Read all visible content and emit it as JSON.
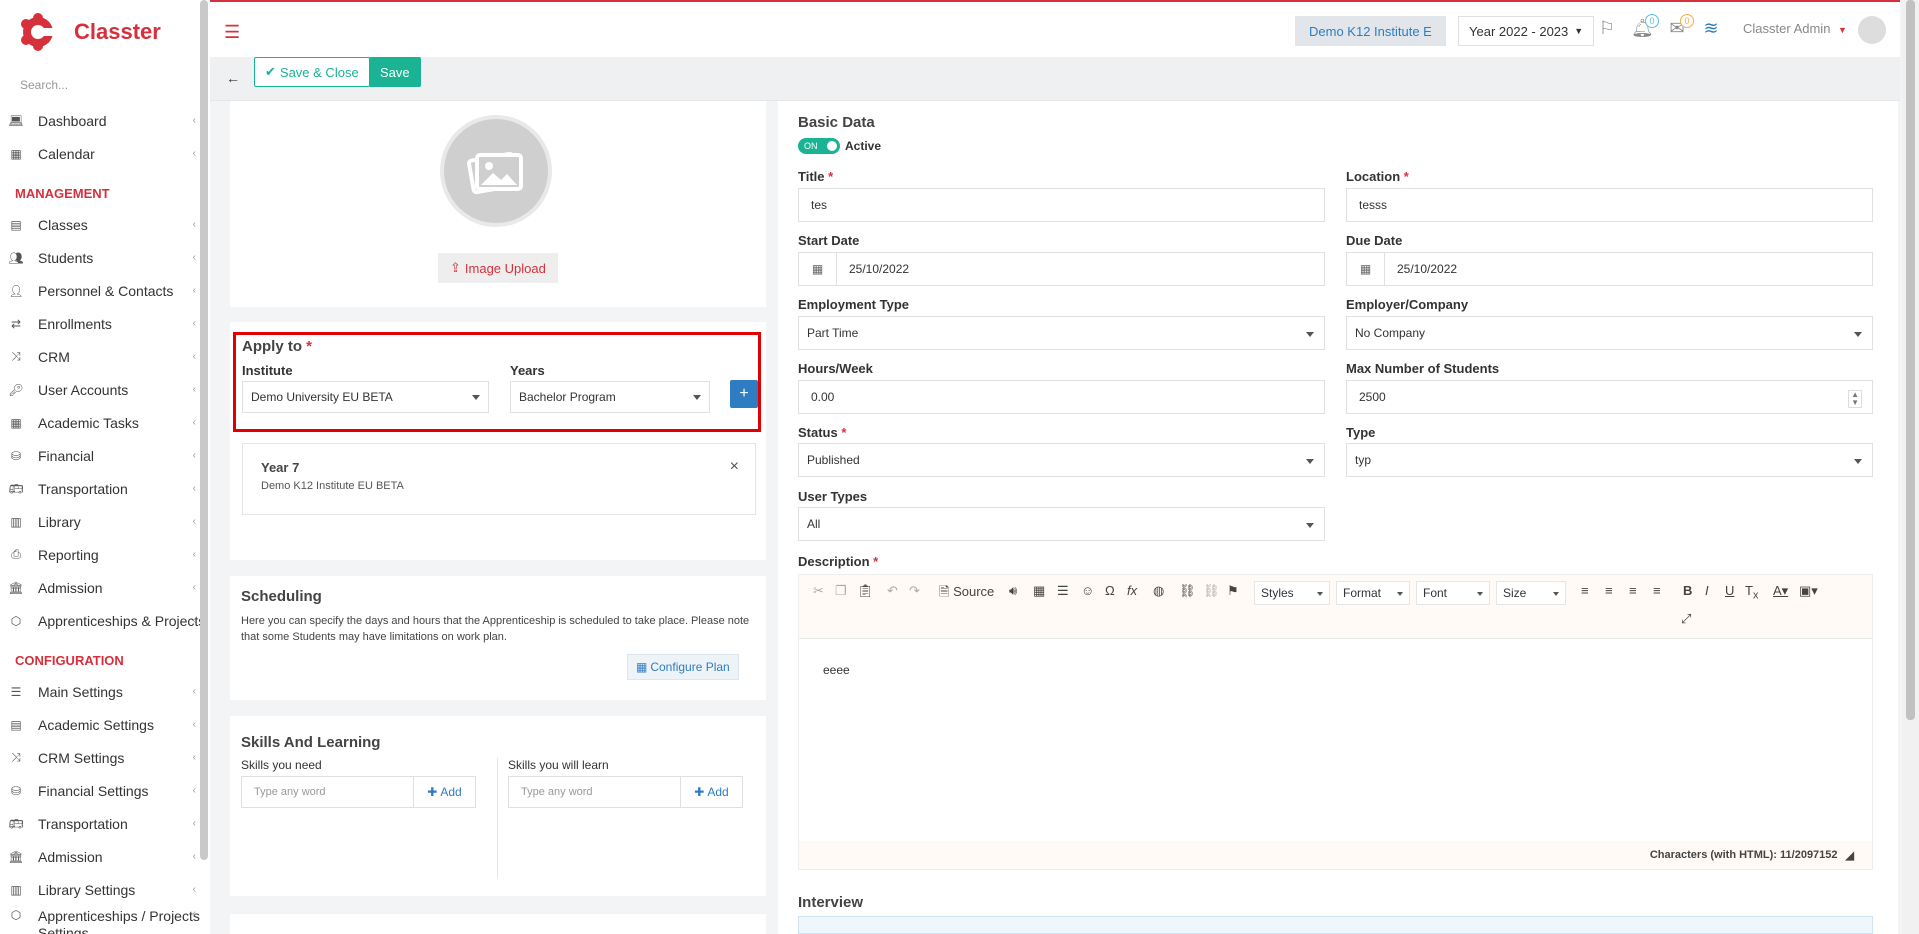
{
  "app": {
    "name": "Classter",
    "search_placeholder": "Search..."
  },
  "sidebar": {
    "items_top": [
      {
        "label": "Dashboard",
        "icon": "laptop-icon"
      },
      {
        "label": "Calendar",
        "icon": "calendar-icon"
      }
    ],
    "section_management": "MANAGEMENT",
    "items_management": [
      {
        "label": "Classes",
        "icon": "classes-icon"
      },
      {
        "label": "Students",
        "icon": "students-icon"
      },
      {
        "label": "Personnel & Contacts",
        "icon": "person-icon"
      },
      {
        "label": "Enrollments",
        "icon": "exchange-icon"
      },
      {
        "label": "CRM",
        "icon": "crm-icon"
      },
      {
        "label": "User Accounts",
        "icon": "key-icon"
      },
      {
        "label": "Academic Tasks",
        "icon": "tasks-icon"
      },
      {
        "label": "Financial",
        "icon": "coins-icon"
      },
      {
        "label": "Transportation",
        "icon": "bus-icon"
      },
      {
        "label": "Library",
        "icon": "library-icon"
      },
      {
        "label": "Reporting",
        "icon": "print-icon"
      },
      {
        "label": "Admission",
        "icon": "bank-icon"
      },
      {
        "label": "Apprenticeships & Projects",
        "icon": "cube-icon"
      }
    ],
    "section_configuration": "CONFIGURATION",
    "items_configuration": [
      {
        "label": "Main Settings",
        "icon": "sliders-icon"
      },
      {
        "label": "Academic Settings",
        "icon": "classes-icon"
      },
      {
        "label": "CRM Settings",
        "icon": "crm-icon"
      },
      {
        "label": "Financial Settings",
        "icon": "coins-icon"
      },
      {
        "label": "Transportation",
        "icon": "bus-icon"
      },
      {
        "label": "Admission",
        "icon": "bank-icon"
      },
      {
        "label": "Library Settings",
        "icon": "library-icon"
      },
      {
        "label": "Apprenticeships / Projects Settings",
        "icon": "cube-icon"
      }
    ]
  },
  "topbar": {
    "institute": "Demo K12 Institute E",
    "year": "Year 2022 - 2023",
    "notif_count": "0",
    "mail_count": "0",
    "user": "Classter Admin"
  },
  "actions": {
    "save_close": "Save & Close",
    "save": "Save"
  },
  "left": {
    "image_upload": "Image Upload",
    "apply_to": {
      "title": "Apply to",
      "institute_label": "Institute",
      "institute_value": "Demo University EU BETA",
      "years_label": "Years",
      "years_value": "Bachelor Program",
      "add": "+"
    },
    "year_card": {
      "title": "Year 7",
      "subtitle": "Demo K12 Institute EU BETA",
      "close": "×"
    },
    "scheduling": {
      "title": "Scheduling",
      "text": "Here you can specify the days and hours that the Apprenticeship is scheduled to take place. Please note that some Students may have limitations on work plan.",
      "button": "Configure Plan"
    },
    "skills": {
      "title": "Skills And Learning",
      "need_label": "Skills you need",
      "learn_label": "Skills you will learn",
      "placeholder": "Type any word",
      "add": "Add"
    }
  },
  "basic": {
    "title": "Basic Data",
    "toggle": "ON",
    "active": "Active",
    "fields": {
      "title_label": "Title",
      "title_value": "tes",
      "location_label": "Location",
      "location_value": "tesss",
      "start_label": "Start Date",
      "start_value": "25/10/2022",
      "due_label": "Due Date",
      "due_value": "25/10/2022",
      "emp_type_label": "Employment Type",
      "emp_type_value": "Part Time",
      "employer_label": "Employer/Company",
      "employer_value": "No Company",
      "hours_label": "Hours/Week",
      "hours_value": "0.00",
      "max_label": "Max Number of Students",
      "max_value": "2500",
      "status_label": "Status",
      "status_value": "Published",
      "type_label": "Type",
      "type_value": "typ",
      "user_types_label": "User Types",
      "user_types_value": "All",
      "desc_label": "Description"
    },
    "editor": {
      "source": "Source",
      "styles": "Styles",
      "format": "Format",
      "font": "Font",
      "size": "Size",
      "content": "eeee",
      "chars": "Characters (with HTML): 11/2097152"
    },
    "interview": "Interview"
  },
  "colors": {
    "brand": "#d6303b",
    "green": "#1ab394",
    "blue": "#2e7dc2",
    "highlight": "#e00000"
  }
}
